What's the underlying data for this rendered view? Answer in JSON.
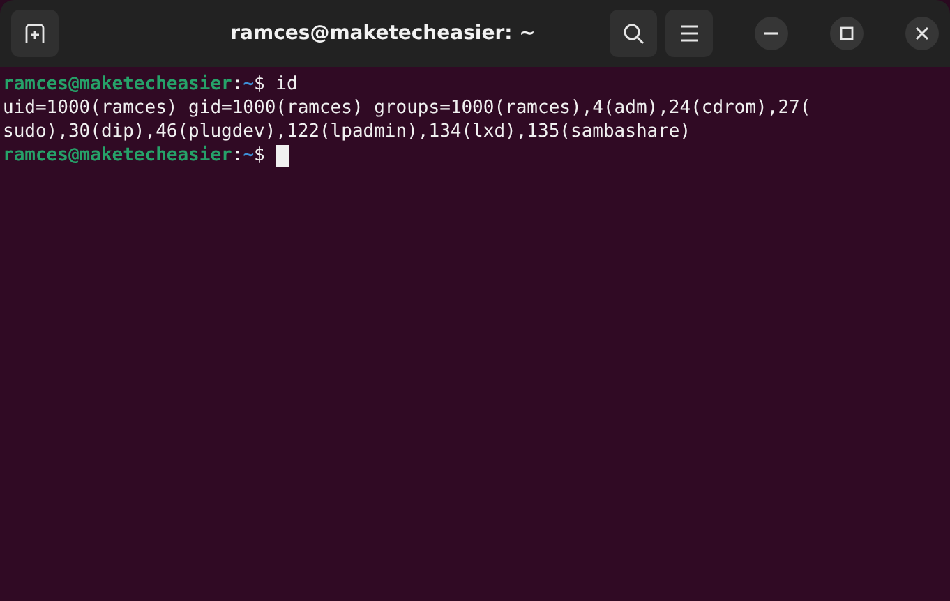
{
  "window": {
    "title": "ramces@maketecheasier: ~"
  },
  "lines": [
    {
      "kind": "prompt",
      "user_host": "ramces@maketecheasier",
      "separator": ":",
      "path": "~",
      "symbol": "$",
      "command": "id",
      "cursor": false
    },
    {
      "kind": "output",
      "text": "uid=1000(ramces) gid=1000(ramces) groups=1000(ramces),4(adm),24(cdrom),27("
    },
    {
      "kind": "output",
      "text": "sudo),30(dip),46(plugdev),122(lpadmin),134(lxd),135(sambashare)"
    },
    {
      "kind": "prompt",
      "user_host": "ramces@maketecheasier",
      "separator": ":",
      "path": "~",
      "symbol": "$",
      "cursor": true
    }
  ]
}
